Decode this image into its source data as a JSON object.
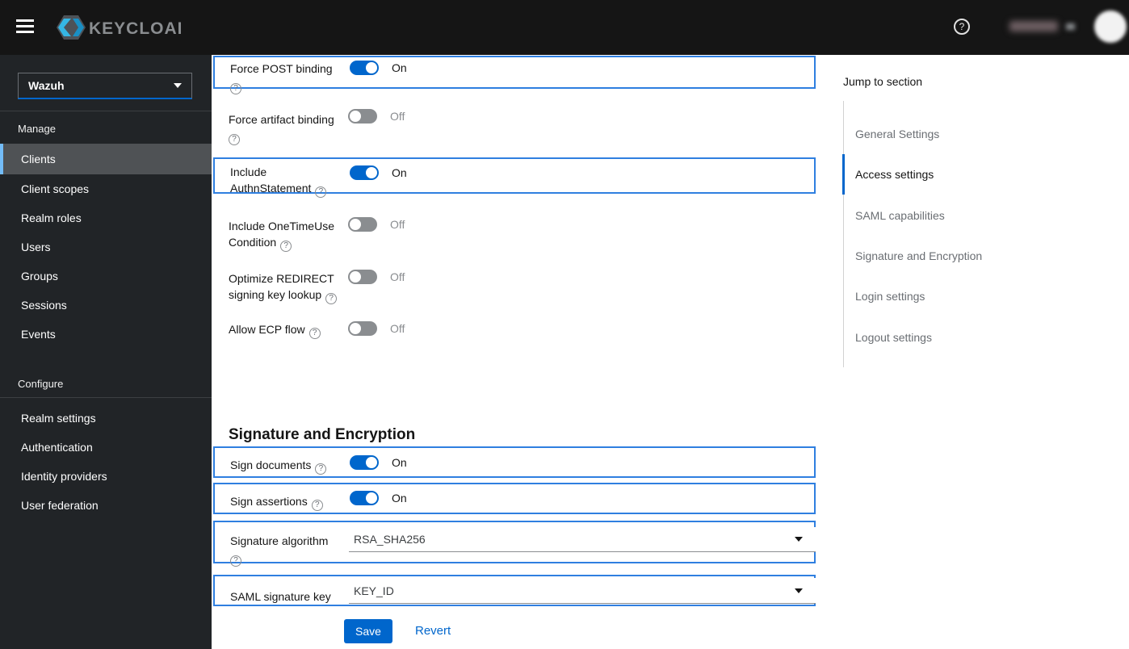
{
  "masthead": {
    "brand": "KEYCLOAK",
    "help_icon": "question-circle-icon",
    "help_glyph": "?",
    "user_menu_note": "username and avatar blurred in screenshot"
  },
  "sidebar": {
    "realm_selector": {
      "value": "Wazuh",
      "icon": "chevron-down-icon"
    },
    "groups": [
      {
        "title": "Manage",
        "items": [
          {
            "label": "Clients",
            "active": true
          },
          {
            "label": "Client scopes",
            "active": false
          },
          {
            "label": "Realm roles",
            "active": false
          },
          {
            "label": "Users",
            "active": false
          },
          {
            "label": "Groups",
            "active": false
          },
          {
            "label": "Sessions",
            "active": false
          },
          {
            "label": "Events",
            "active": false
          }
        ]
      },
      {
        "title": "Configure",
        "items": [
          {
            "label": "Realm settings",
            "active": false
          },
          {
            "label": "Authentication",
            "active": false
          },
          {
            "label": "Identity providers",
            "active": false
          },
          {
            "label": "User federation",
            "active": false
          }
        ]
      }
    ]
  },
  "main": {
    "section_heading": "Signature and Encryption",
    "help_glyph": "?",
    "rows": [
      {
        "id": "force-post-binding",
        "label_lines": [
          "Force POST binding"
        ],
        "help": "below",
        "control": "toggle",
        "state": "On",
        "on": true,
        "highlighted": true
      },
      {
        "id": "force-artifact-binding",
        "label_lines": [
          "Force artifact binding"
        ],
        "help": "below",
        "control": "toggle",
        "state": "Off",
        "on": false,
        "highlighted": false
      },
      {
        "id": "include-authnstatement",
        "label_lines": [
          "Include",
          "AuthnStatement"
        ],
        "help": "inline",
        "control": "toggle",
        "state": "On",
        "on": true,
        "highlighted": true
      },
      {
        "id": "include-onetimeuse-condition",
        "label_lines": [
          "Include OneTimeUse",
          "Condition"
        ],
        "help": "inline",
        "control": "toggle",
        "state": "Off",
        "on": false,
        "highlighted": false
      },
      {
        "id": "optimize-redirect-signing-key-lookup",
        "label_lines": [
          "Optimize REDIRECT",
          "signing key lookup"
        ],
        "help": "inline",
        "control": "toggle",
        "state": "Off",
        "on": false,
        "highlighted": false
      },
      {
        "id": "allow-ecp-flow",
        "label_lines": [
          "Allow ECP flow"
        ],
        "help": "inline",
        "control": "toggle",
        "state": "Off",
        "on": false,
        "highlighted": false
      },
      {
        "id": "sign-documents",
        "label_lines": [
          "Sign documents"
        ],
        "help": "inline",
        "control": "toggle",
        "state": "On",
        "on": true,
        "highlighted": true
      },
      {
        "id": "sign-assertions",
        "label_lines": [
          "Sign assertions"
        ],
        "help": "inline",
        "control": "toggle",
        "state": "On",
        "on": true,
        "highlighted": true
      },
      {
        "id": "signature-algorithm",
        "label_lines": [
          "Signature algorithm"
        ],
        "help": "below",
        "control": "select",
        "value": "RSA_SHA256",
        "highlighted": true
      },
      {
        "id": "saml-signature-key",
        "label_lines": [
          "SAML signature key"
        ],
        "help": "none",
        "control": "select",
        "value": "KEY_ID",
        "highlighted": true
      }
    ],
    "buttons": {
      "save": "Save",
      "revert": "Revert"
    }
  },
  "jump_rail": {
    "title": "Jump to section",
    "items": [
      {
        "label": "General Settings",
        "active": false
      },
      {
        "label": "Access settings",
        "active": true
      },
      {
        "label": "SAML capabilities",
        "active": false
      },
      {
        "label": "Signature and Encryption",
        "active": false
      },
      {
        "label": "Login settings",
        "active": false
      },
      {
        "label": "Logout settings",
        "active": false
      }
    ]
  },
  "colors": {
    "accent": "#0066cc",
    "highlight_border": "#2f7fe0",
    "nav_active_border": "#73bcf7",
    "toggle_off": "#8a8d90",
    "masthead_bg": "#151515",
    "sidebar_bg": "#212427"
  }
}
